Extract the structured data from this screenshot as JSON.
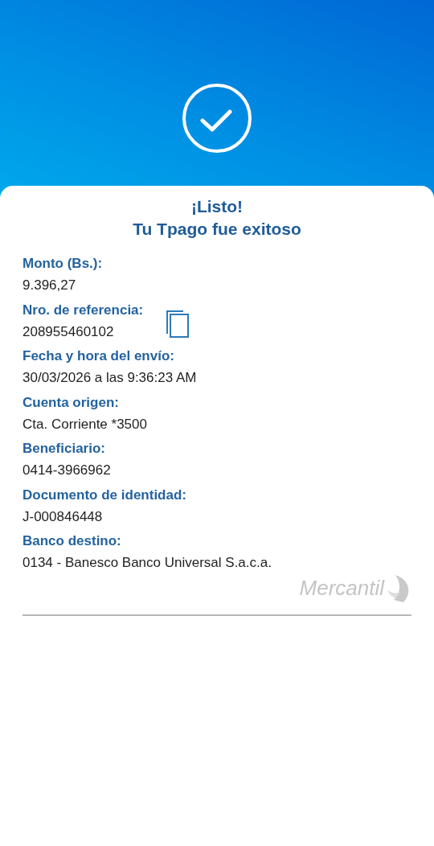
{
  "title": {
    "line_1": "¡Listo!",
    "line_2": "Tu Tpago fue exitoso"
  },
  "fields": [
    {
      "label": "Monto (Bs.):",
      "value": "9.396,27",
      "copyable": false
    },
    {
      "label": "Nro. de referencia:",
      "value": "208955460102",
      "copyable": true
    },
    {
      "label": "Fecha y hora del envío:",
      "value": "30/03/2026 a las 9:36:23 AM",
      "copyable": false
    },
    {
      "label": "Cuenta origen:",
      "value": "Cta. Corriente *3500",
      "copyable": false
    },
    {
      "label": "Beneficiario:",
      "value": "0414-3966962",
      "copyable": false
    },
    {
      "label": "Documento de identidad:",
      "value": "J-000846448",
      "copyable": false
    },
    {
      "label": "Banco destino:",
      "value": "0134 - Banesco Banco Universal S.a.c.a.",
      "copyable": false
    }
  ],
  "logo": {
    "text": "Mercantil"
  }
}
